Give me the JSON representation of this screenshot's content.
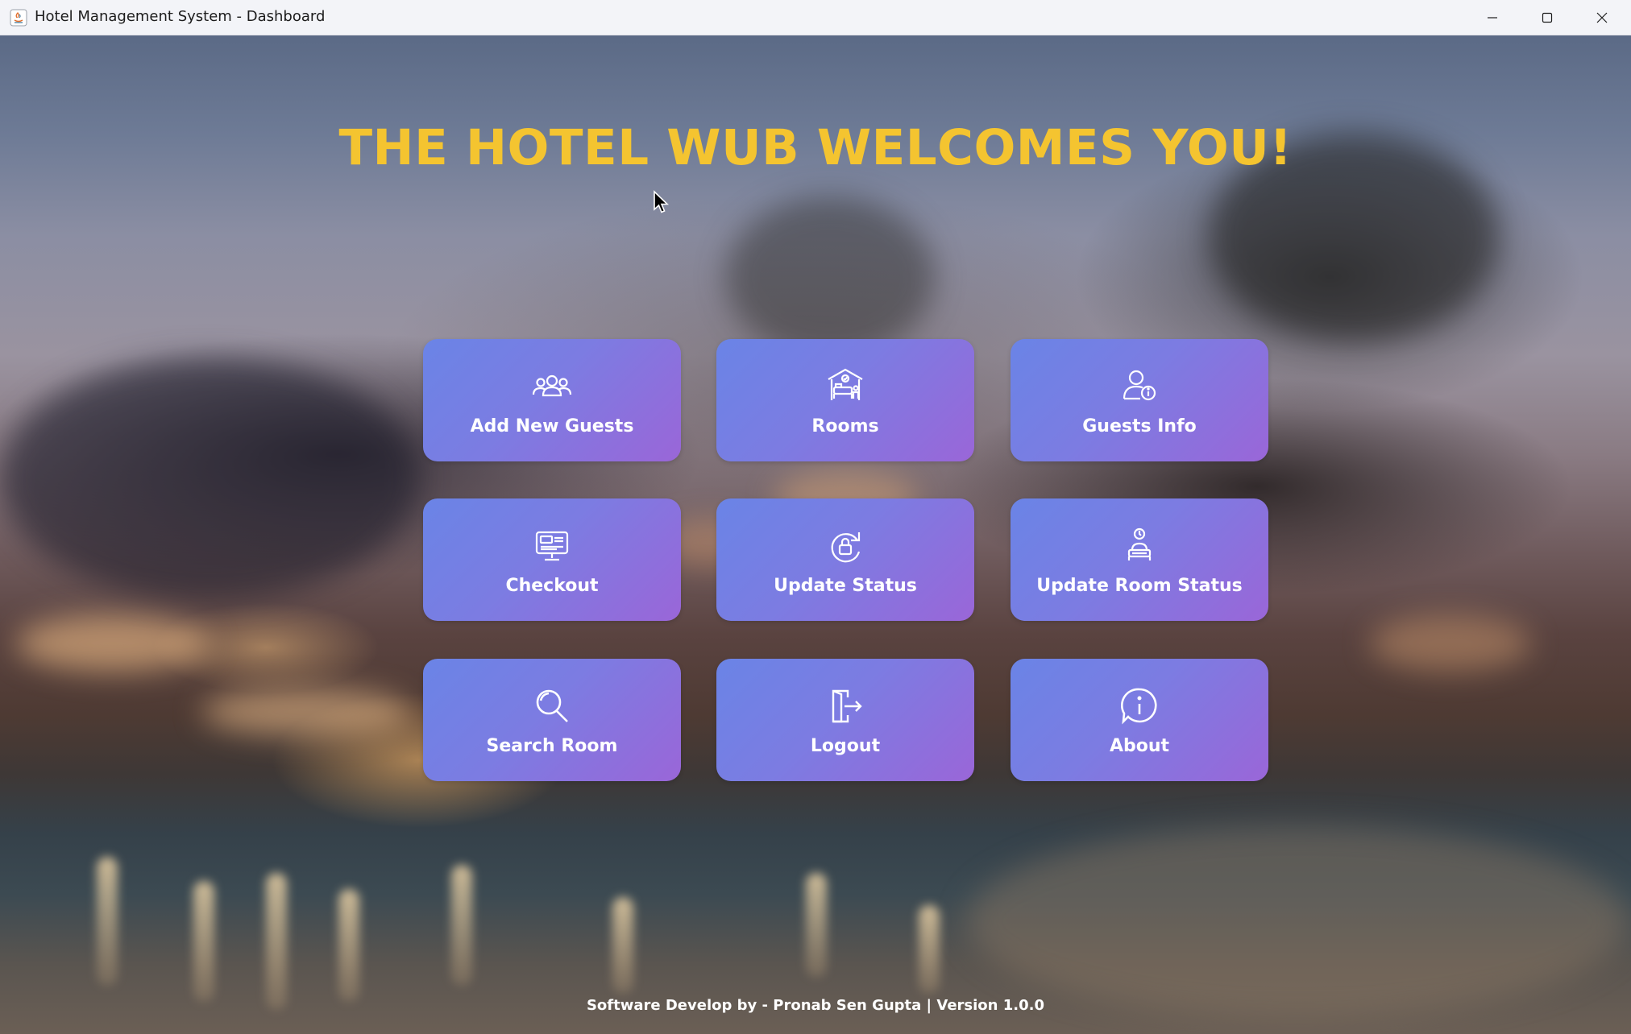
{
  "window": {
    "title": "Hotel Management System - Dashboard"
  },
  "headline": "THE HOTEL WUB WELCOMES YOU!",
  "tiles": [
    {
      "label": "Add New Guests",
      "icon": "guests-icon"
    },
    {
      "label": "Rooms",
      "icon": "hotel-room-icon"
    },
    {
      "label": "Guests Info",
      "icon": "user-info-icon"
    },
    {
      "label": "Checkout",
      "icon": "checkout-monitor-icon"
    },
    {
      "label": "Update Status",
      "icon": "refresh-lock-icon"
    },
    {
      "label": "Update Room Status",
      "icon": "room-status-icon"
    },
    {
      "label": "Search Room",
      "icon": "search-icon"
    },
    {
      "label": "Logout",
      "icon": "logout-icon"
    },
    {
      "label": "About",
      "icon": "info-icon"
    }
  ],
  "footer": "Software Develop by - Pronab Sen Gupta | Version 1.0.0",
  "colors": {
    "headline": "#f4c430",
    "tile_start": "#6a84e6",
    "tile_end": "#9a66d8"
  }
}
